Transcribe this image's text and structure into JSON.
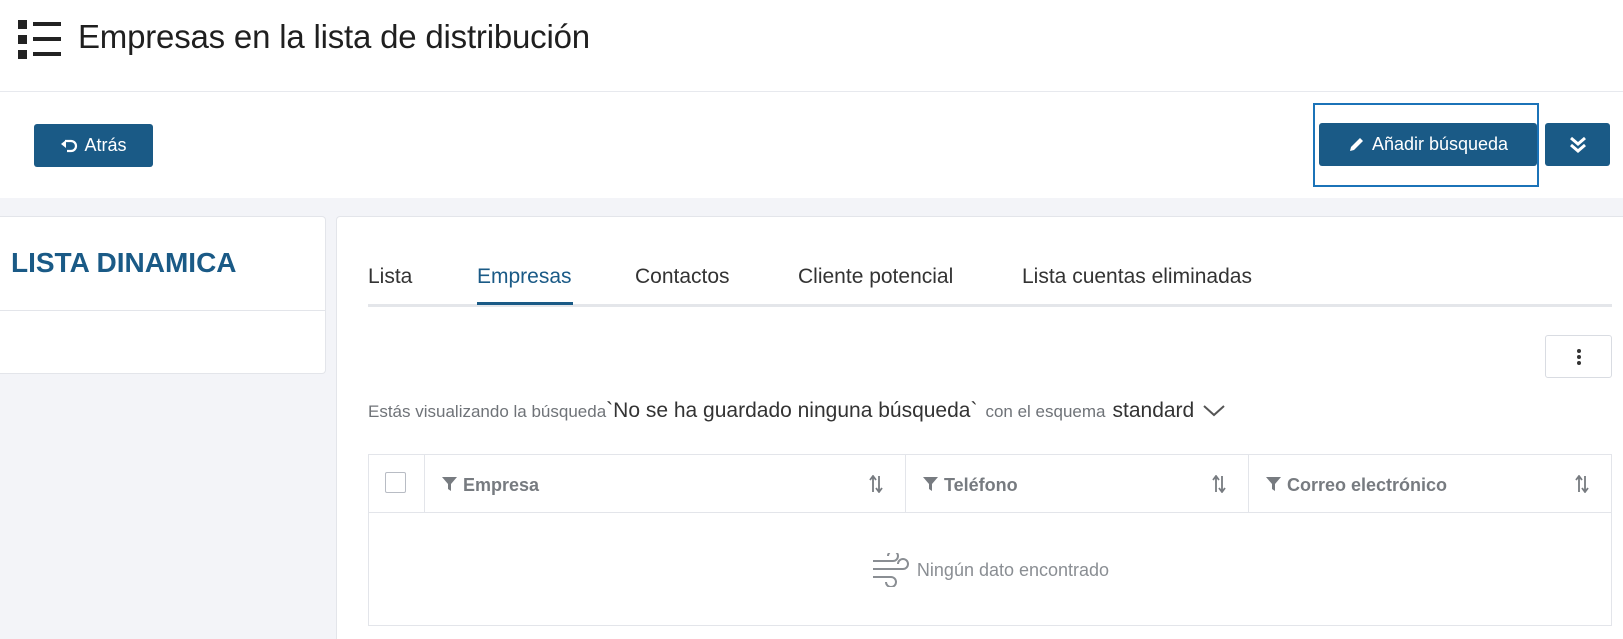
{
  "header": {
    "title": "Empresas en la lista de distribución",
    "icon": "list-icon"
  },
  "toolbar": {
    "back_label": "Atrás",
    "back_icon": "undo-icon",
    "add_search_label": "Añadir búsqueda",
    "add_search_icon": "pencil-icon",
    "more_icon": "double-chevron-down-icon"
  },
  "sidebar": {
    "title": "LISTA DINAMICA"
  },
  "tabs": [
    {
      "label": "Lista",
      "active": false
    },
    {
      "label": "Empresas",
      "active": true
    },
    {
      "label": "Contactos",
      "active": false
    },
    {
      "label": "Cliente potencial",
      "active": false
    },
    {
      "label": "Lista cuentas eliminadas",
      "active": false
    }
  ],
  "info": {
    "prefix": "Estás visualizando la búsqueda",
    "search_name": "`No se ha guardado ninguna búsqueda`",
    "middle": "con el esquema",
    "scheme": "standard"
  },
  "table": {
    "columns": [
      {
        "label": "Empresa"
      },
      {
        "label": "Teléfono"
      },
      {
        "label": "Correo electrónico"
      }
    ],
    "rows": [],
    "empty_text": "Ningún dato encontrado"
  },
  "colors": {
    "primary": "#1a5a86",
    "highlight": "#1b73b8",
    "background": "#f3f4f8"
  }
}
